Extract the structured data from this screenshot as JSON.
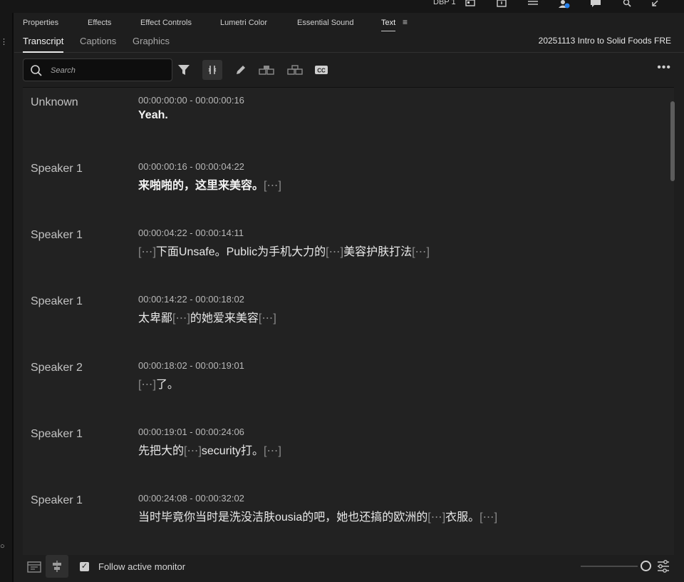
{
  "topbar": {
    "workspace_label": "DBP 1"
  },
  "panel_tabs": [
    {
      "label": "Properties"
    },
    {
      "label": "Effects"
    },
    {
      "label": "Effect Controls"
    },
    {
      "label": "Lumetri Color"
    },
    {
      "label": "Essential Sound"
    },
    {
      "label": "Text"
    }
  ],
  "sub_tabs": [
    {
      "label": "Transcript"
    },
    {
      "label": "Captions"
    },
    {
      "label": "Graphics"
    }
  ],
  "sequence_name": "20251113 Intro to Solid Foods FRE",
  "search": {
    "placeholder": "Search",
    "value": ""
  },
  "toolbar_icons": [
    "filter-icon",
    "split-segment-icon",
    "pencil-icon",
    "merge-segments-icon",
    "speaker-icon",
    "captions-cc-icon",
    "more-options-icon"
  ],
  "ellipsis_glyph": "[⋯]",
  "segments": [
    {
      "speaker": "Unknown",
      "timecode": "00:00:00:00 - 00:00:00:16",
      "parts": [
        {
          "t": "Yeah.",
          "k": "b"
        }
      ]
    },
    {
      "speaker": "Speaker 1",
      "timecode": "00:00:00:16 - 00:00:04:22",
      "parts": [
        {
          "t": "来啪啪的，这里来美容。",
          "k": "b"
        },
        {
          "t": "[⋯]",
          "k": "e"
        }
      ]
    },
    {
      "speaker": "Speaker 1",
      "timecode": "00:00:04:22 - 00:00:14:11",
      "parts": [
        {
          "t": "[⋯]",
          "k": "e"
        },
        {
          "t": "下面Unsafe。Public为手机大力的",
          "k": "p"
        },
        {
          "t": "[⋯]",
          "k": "e"
        },
        {
          "t": "美容护肤打法",
          "k": "p"
        },
        {
          "t": "[⋯]",
          "k": "e"
        }
      ]
    },
    {
      "speaker": "Speaker 1",
      "timecode": "00:00:14:22 - 00:00:18:02",
      "parts": [
        {
          "t": "太卑鄙",
          "k": "p"
        },
        {
          "t": "[⋯]",
          "k": "e"
        },
        {
          "t": "的她爱来美容",
          "k": "p"
        },
        {
          "t": "[⋯]",
          "k": "e"
        }
      ]
    },
    {
      "speaker": "Speaker 2",
      "timecode": "00:00:18:02 - 00:00:19:01",
      "parts": [
        {
          "t": "[⋯]",
          "k": "e"
        },
        {
          "t": "了。",
          "k": "p"
        }
      ]
    },
    {
      "speaker": "Speaker 1",
      "timecode": "00:00:19:01 - 00:00:24:06",
      "parts": [
        {
          "t": "先把大的",
          "k": "p"
        },
        {
          "t": "[⋯]",
          "k": "e"
        },
        {
          "t": "security打。",
          "k": "p"
        },
        {
          "t": "[⋯]",
          "k": "e"
        }
      ]
    },
    {
      "speaker": "Speaker 1",
      "timecode": "00:00:24:08 - 00:00:32:02",
      "parts": [
        {
          "t": "当时毕竟你当时是洗没洁肤ousia的吧，她也还搞的欧洲的",
          "k": "p"
        },
        {
          "t": "[⋯]",
          "k": "e"
        },
        {
          "t": "衣服。",
          "k": "p"
        },
        {
          "t": "[⋯]",
          "k": "e"
        }
      ]
    }
  ],
  "footer": {
    "follow_label": "Follow active monitor",
    "follow_checked": true
  },
  "colors": {
    "panel_bg": "#1e1e1e",
    "transcript_bg": "#222222",
    "text_primary": "#f2f2f2",
    "text_muted": "#8a8a8a"
  }
}
